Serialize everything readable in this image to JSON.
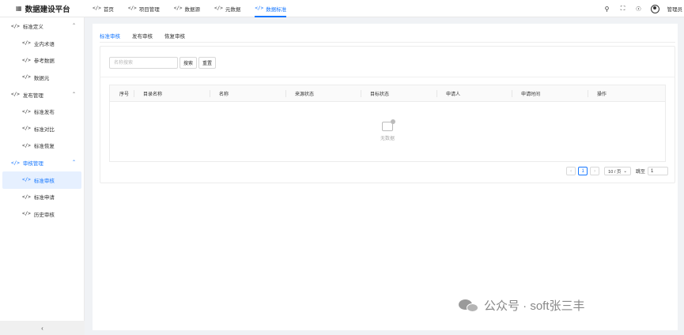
{
  "app": {
    "title": "数据建设平台",
    "logo_icon": "grid-icon"
  },
  "top_nav": [
    {
      "label": "首页",
      "active": false
    },
    {
      "label": "项目管理",
      "active": false
    },
    {
      "label": "数据源",
      "active": false
    },
    {
      "label": "元数据",
      "active": false
    },
    {
      "label": "数据标准",
      "active": true
    }
  ],
  "top_right": {
    "user_name": "管理员"
  },
  "sidebar": {
    "groups": [
      {
        "label": "标准定义",
        "items": [
          "业内术语",
          "参考数据",
          "数据元"
        ]
      },
      {
        "label": "发布管理",
        "items": [
          "标准发布",
          "标准对比",
          "标准恢复"
        ]
      },
      {
        "label": "审核管理",
        "items": [
          "标准审核",
          "标准申请",
          "历史审核"
        ]
      }
    ],
    "active_group": "审核管理",
    "active_item": "标准审核",
    "collapse_glyph": "‹"
  },
  "tabs": [
    {
      "label": "标准审核",
      "active": true
    },
    {
      "label": "发布审核",
      "active": false
    },
    {
      "label": "恢复审核",
      "active": false
    }
  ],
  "search": {
    "placeholder": "名称搜索",
    "value": "",
    "search_label": "搜索",
    "reset_label": "重置"
  },
  "table": {
    "columns": [
      "序号",
      "目录名称",
      "名称",
      "来源状态",
      "目标状态",
      "申请人",
      "申请时间",
      "操作"
    ],
    "rows": [],
    "empty_text": "无数据"
  },
  "pagination": {
    "prev": "‹",
    "current_page": "1",
    "next": "›",
    "page_size": "10 / 页",
    "jump_label": "跳至",
    "jump_value": "1"
  },
  "watermark": {
    "text": "公众号 · soft张三丰"
  }
}
